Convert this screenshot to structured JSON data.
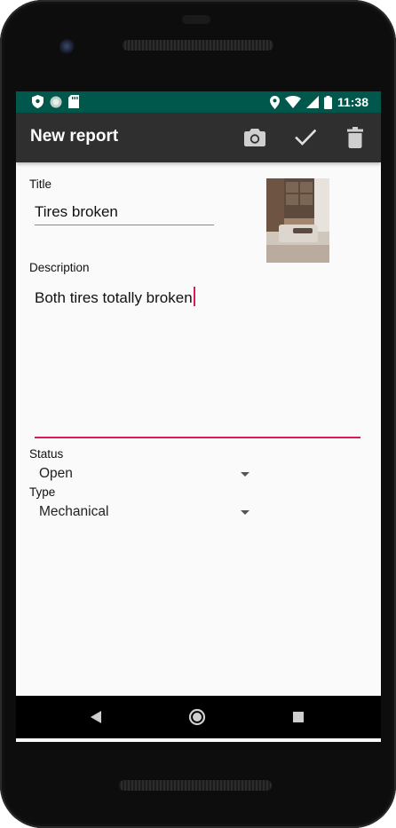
{
  "statusbar": {
    "time": "11:38",
    "icons_left": [
      "shield-icon",
      "circle-icon",
      "sd-card-icon"
    ],
    "icons_right": [
      "location-icon",
      "wifi-icon",
      "signal-icon",
      "battery-icon"
    ],
    "background": "#00574b"
  },
  "toolbar": {
    "title": "New report",
    "actions": [
      "camera-icon",
      "check-icon",
      "delete-icon"
    ],
    "background": "#2f2f2f"
  },
  "form": {
    "title_label": "Title",
    "title_value": "Tires broken",
    "description_label": "Description",
    "description_value": "Both tires totally broken",
    "status_label": "Status",
    "status_value": "Open",
    "type_label": "Type",
    "type_value": "Mechanical",
    "accent_color": "#d81b60"
  },
  "navbar": {
    "buttons": [
      "back-icon",
      "home-icon",
      "recents-icon"
    ]
  }
}
